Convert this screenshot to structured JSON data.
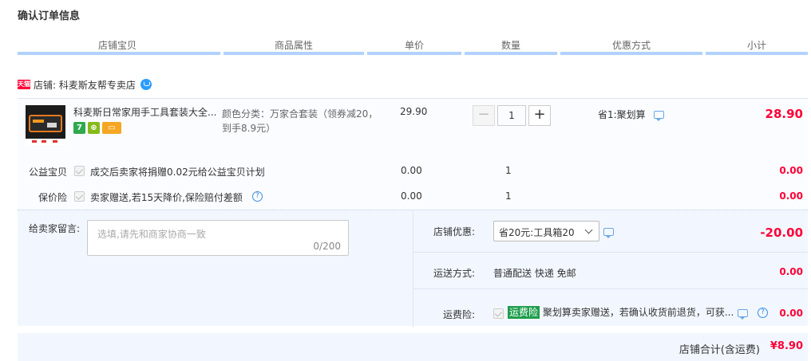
{
  "page_title": "确认订单信息",
  "columns": [
    "店铺宝贝",
    "商品属性",
    "单价",
    "数量",
    "优惠方式",
    "小计"
  ],
  "shop": {
    "tmall_badge": "天猫",
    "label": "店铺: 科麦斯友帮专卖店"
  },
  "item": {
    "name": "科麦斯日常家用手工具套装大全...",
    "badges": [
      "7",
      "⊕",
      "▭"
    ],
    "attribute": "颜色分类：万家合套装（领券减20，到手8.9元）",
    "unit_price": "29.90",
    "quantity": "1",
    "minus_label": "−",
    "plus_label": "+",
    "promo": "省1:聚划算",
    "subtotal": "28.90"
  },
  "services": [
    {
      "label": "公益宝贝",
      "text": "成交后卖家将捐赠0.02元给公益宝贝计划",
      "price": "0.00",
      "qty": "1",
      "subtotal": "0.00"
    },
    {
      "label": "保价险",
      "text": "卖家赠送,若15天降价,保险赔付差额",
      "price": "0.00",
      "qty": "1",
      "subtotal": "0.00",
      "help": "?"
    }
  ],
  "message": {
    "label": "给卖家留言:",
    "placeholder": "选填,请先和商家协商一致",
    "count": "0/200"
  },
  "shop_discount": {
    "label": "店铺优惠:",
    "selected": "省20元:工具箱20",
    "amount": "-20.00"
  },
  "shipping": {
    "label": "运送方式:",
    "value": "普通配送 快递 免邮",
    "amount": "0.00"
  },
  "freight_insurance": {
    "label": "运费险:",
    "tag": "运费险",
    "text": "聚划算卖家赠送，若确认收货前退货，可获...",
    "help": "?",
    "amount": "0.00"
  },
  "total": {
    "label": "店铺合计(含运费)",
    "value": "¥8.90"
  },
  "colors": {
    "accent_red": "#ff0036",
    "header_line": "#b2d1ff",
    "panel_bg": "#f2f7ff"
  }
}
